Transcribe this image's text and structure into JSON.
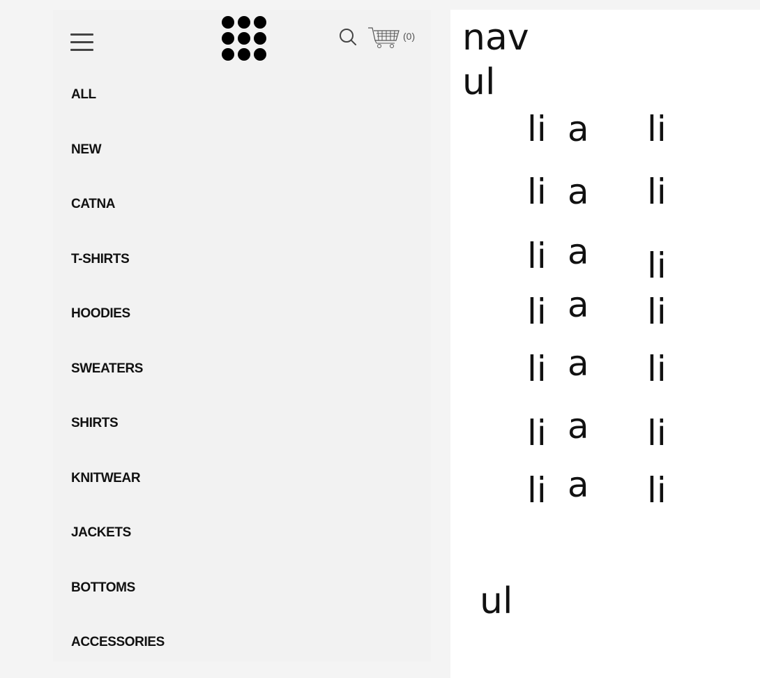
{
  "header": {
    "menu_icon": "hamburger-icon",
    "logo_icon": "dot-grid-logo-icon",
    "search_icon": "search-icon",
    "cart_icon": "shopping-cart-icon",
    "cart_count": "(0)"
  },
  "menu": {
    "items": [
      {
        "label": "ALL"
      },
      {
        "label": "NEW"
      },
      {
        "label": "CATNA"
      },
      {
        "label": "T-SHIRTS"
      },
      {
        "label": "HOODIES"
      },
      {
        "label": "SWEATERS"
      },
      {
        "label": "SHIRTS"
      },
      {
        "label": "KNITWEAR"
      },
      {
        "label": "JACKETS"
      },
      {
        "label": "BOTTOMS"
      },
      {
        "label": "ACCESSORIES"
      }
    ]
  },
  "debug": {
    "nav": "nav",
    "ul_top": "ul",
    "ul_bottom": "ul",
    "rows": [
      {
        "li_left": "li",
        "a": "a",
        "li_right": "li"
      },
      {
        "li_left": "li",
        "a": "a",
        "li_right": "li"
      },
      {
        "li_left": "li",
        "a": "a",
        "li_right": "li"
      },
      {
        "li_left": "li",
        "a": "a",
        "li_right": "li"
      },
      {
        "li_left": "li",
        "a": "a",
        "li_right": "li"
      },
      {
        "li_left": "li",
        "a": "a",
        "li_right": "li"
      },
      {
        "li_left": "li",
        "a": "a",
        "li_right": "li"
      }
    ]
  },
  "colors": {
    "page_bg": "#f4f4f4",
    "menu_bg": "#f2f2f2",
    "debug_bg": "#ffffff",
    "text": "#111111",
    "icon": "#444444"
  }
}
